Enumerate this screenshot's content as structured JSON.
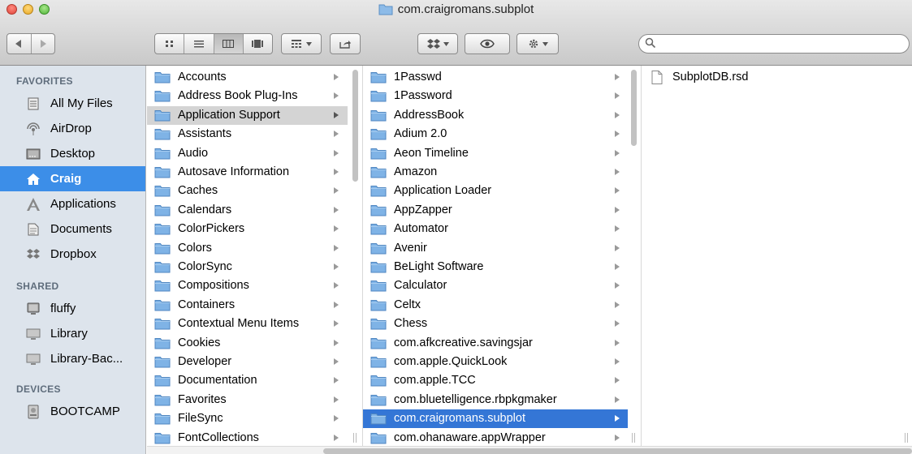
{
  "window": {
    "title": "com.craigromans.subplot"
  },
  "toolbar": {
    "back_icon": "chevron-left-icon",
    "forward_icon": "chevron-right-icon",
    "view_icons": [
      "icon-view-icon",
      "list-view-icon",
      "column-view-icon",
      "cover-flow-icon"
    ],
    "active_view": "column",
    "arrange_icon": "arrange-grid-icon",
    "share_icon": "share-icon",
    "dropbox_icon": "dropbox-icon",
    "quicklook_icon": "eye-icon",
    "action_icon": "gear-icon",
    "search_value": ""
  },
  "sidebar": {
    "favorites_header": "FAVORITES",
    "favorites": [
      {
        "label": "All My Files",
        "icon": "all-files-icon"
      },
      {
        "label": "AirDrop",
        "icon": "airdrop-icon"
      },
      {
        "label": "Desktop",
        "icon": "desktop-icon"
      },
      {
        "label": "Craig",
        "icon": "home-icon",
        "selected": true
      },
      {
        "label": "Applications",
        "icon": "applications-icon"
      },
      {
        "label": "Documents",
        "icon": "documents-icon"
      },
      {
        "label": "Dropbox",
        "icon": "dropbox-icon"
      }
    ],
    "shared_header": "SHARED",
    "shared": [
      {
        "label": "fluffy",
        "icon": "computer-icon"
      },
      {
        "label": "Library",
        "icon": "display-icon"
      },
      {
        "label": "Library-Bac...",
        "icon": "display-icon"
      }
    ],
    "devices_header": "DEVICES",
    "devices": [
      {
        "label": "BOOTCAMP",
        "icon": "drive-icon"
      }
    ]
  },
  "column1": {
    "selected": "Application Support",
    "items": [
      "Accounts",
      "Address Book Plug-Ins",
      "Application Support",
      "Assistants",
      "Audio",
      "Autosave Information",
      "Caches",
      "Calendars",
      "ColorPickers",
      "Colors",
      "ColorSync",
      "Compositions",
      "Containers",
      "Contextual Menu Items",
      "Cookies",
      "Developer",
      "Documentation",
      "Favorites",
      "FileSync",
      "FontCollections"
    ]
  },
  "column2": {
    "selected": "com.craigromans.subplot",
    "items": [
      "1Passwd",
      "1Password",
      "AddressBook",
      "Adium 2.0",
      "Aeon Timeline",
      "Amazon",
      "Application Loader",
      "AppZapper",
      "Automator",
      "Avenir",
      "BeLight Software",
      "Calculator",
      "Celtx",
      "Chess",
      "com.afkcreative.savingsjar",
      "com.apple.QuickLook",
      "com.apple.TCC",
      "com.bluetelligence.rbpkgmaker",
      "com.craigromans.subplot",
      "com.ohanaware.appWrapper"
    ]
  },
  "column3": {
    "items": [
      {
        "label": "SubplotDB.rsd",
        "icon": "document-icon"
      }
    ]
  },
  "colors": {
    "selection_blue": "#3476d6",
    "sidebar_selected": "#3c8ee8",
    "sidebar_bg": "#dde4ec",
    "folder_blue": "#7fb3e6"
  }
}
